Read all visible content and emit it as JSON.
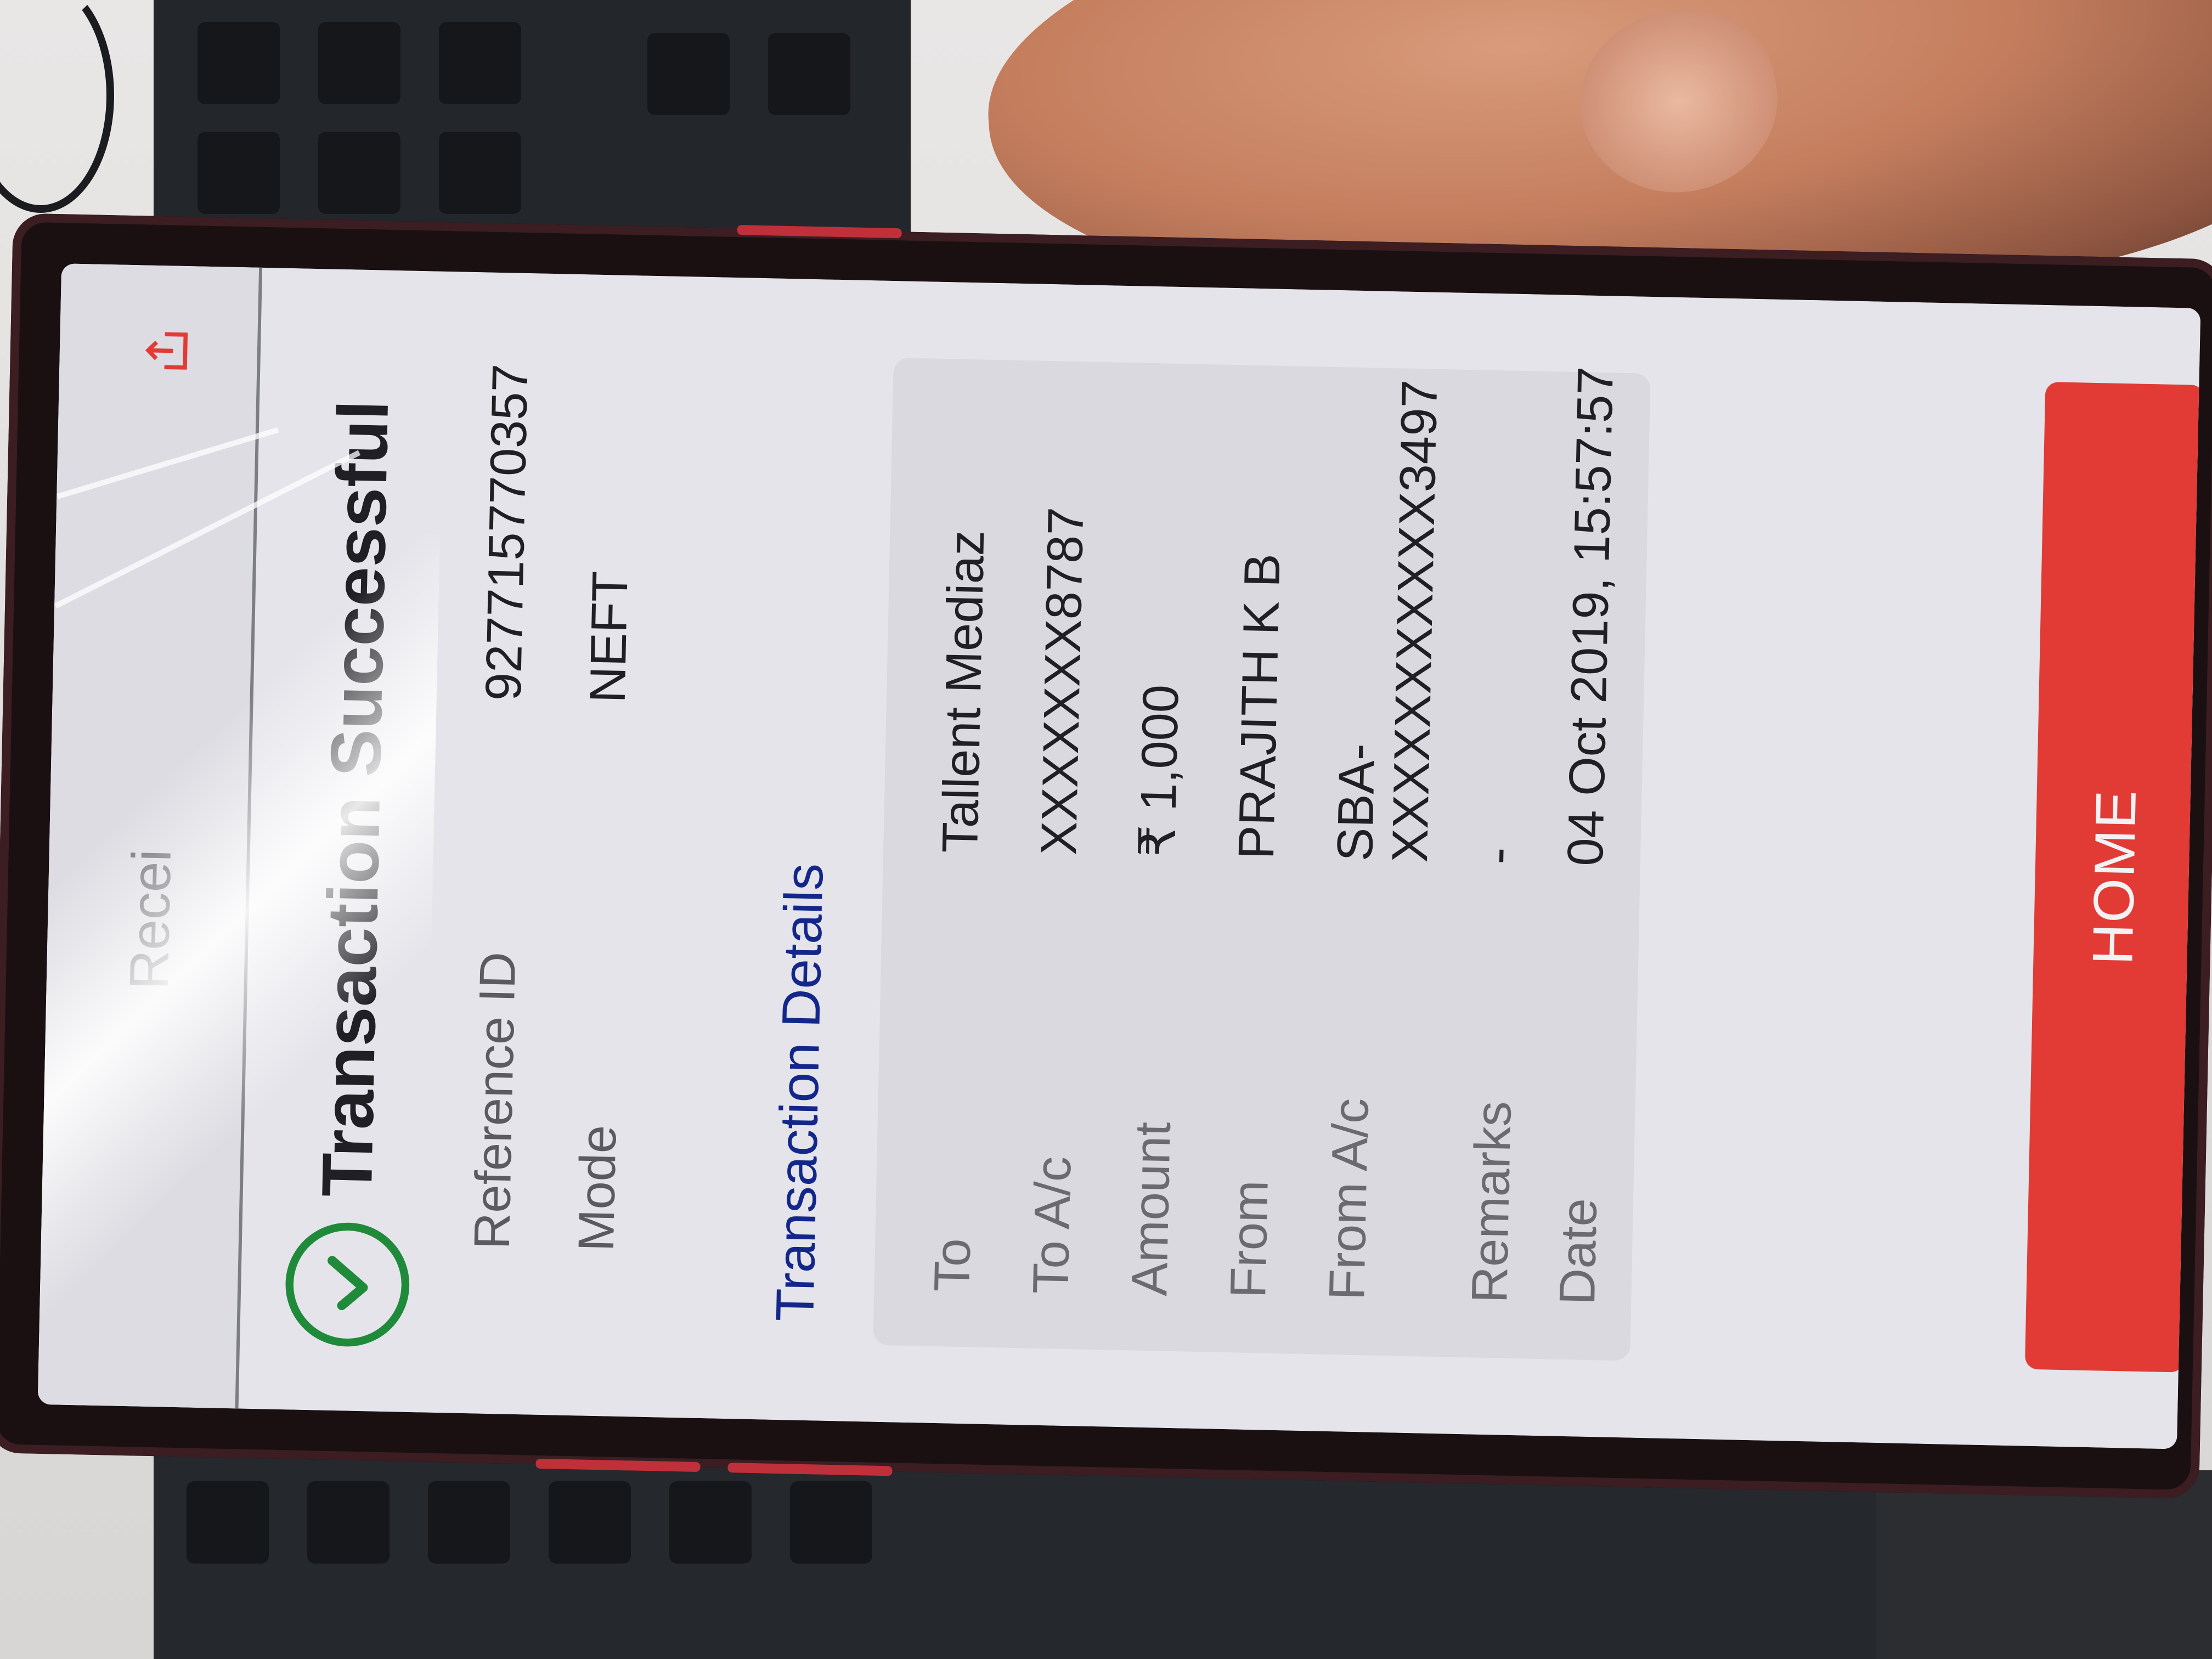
{
  "app": {
    "header_title": "Recei",
    "status_bar": "",
    "status_title": "Transaction Successful",
    "summary": [
      {
        "label": "Reference ID",
        "value": "927715770357"
      },
      {
        "label": "Mode",
        "value": "NEFT"
      }
    ],
    "section_title": "Transaction Details",
    "details": [
      {
        "label": "To",
        "value": "Tallent Mediaz"
      },
      {
        "label": "To A/c",
        "value": "XXXXXXX8787"
      },
      {
        "label": "Amount",
        "value": "₹ 1,000"
      },
      {
        "label": "From",
        "value": "PRAJITH K B"
      },
      {
        "label": "From A/c",
        "value_line1": "SBA-",
        "value_line2": "XXXXXXXXXXX3497"
      },
      {
        "label": "Remarks",
        "value": "-"
      },
      {
        "label": "Date",
        "value": "04 Oct 2019, 15:57:57"
      }
    ],
    "home_button": "HOME"
  },
  "colors": {
    "accent_red": "#e23a34",
    "success_green": "#1f8a3a",
    "link_blue": "#13278a"
  },
  "icons": {
    "success": "check-circle-icon",
    "share": "share-icon"
  }
}
